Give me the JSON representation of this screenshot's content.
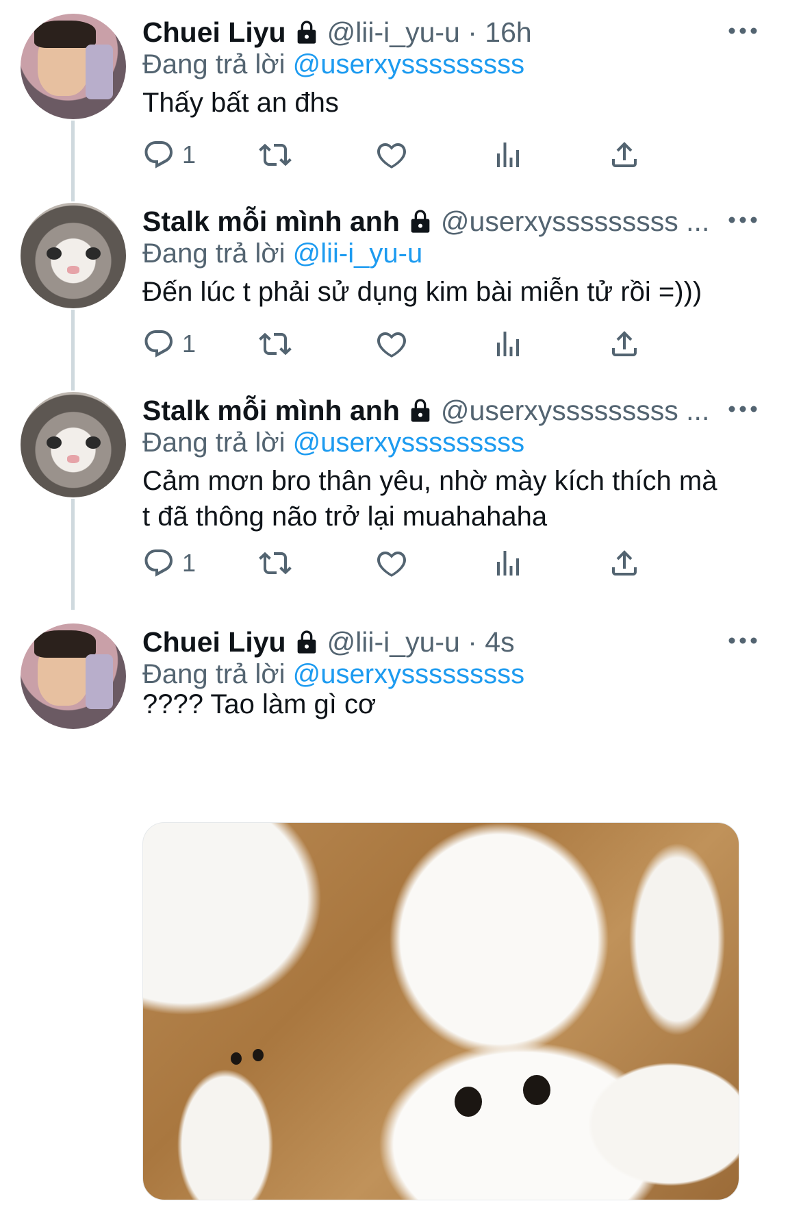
{
  "tweets": [
    {
      "name": "Chuei Liyu",
      "handle": "@lii-i_yu-u · 16h",
      "reply_prefix": "Đang trả lời ",
      "reply_mention": "@userxysssssssss",
      "text": "Thấy bất an đhs",
      "reply_count": "1",
      "avatar": "person-avatar"
    },
    {
      "name": "Stalk mỗi mình anh",
      "handle": "@userxysssssssss ...",
      "reply_prefix": "Đang trả lời ",
      "reply_mention": "@lii-i_yu-u",
      "text": "Đến lúc t phải sử dụng kim bài miễn tử rồi =)))",
      "reply_count": "1",
      "avatar": "cat-avatar"
    },
    {
      "name": "Stalk mỗi mình anh",
      "handle": "@userxysssssssss ...",
      "reply_prefix": "Đang trả lời ",
      "reply_mention": "@userxysssssssss",
      "text": "Cảm mơn bro thân yêu, nhờ mày kích thích mà\nt đã thông não trở lại muahahaha",
      "reply_count": "1",
      "avatar": "cat-avatar"
    },
    {
      "name": "Chuei Liyu",
      "handle": "@lii-i_yu-u · 4s",
      "reply_prefix": "Đang trả lời ",
      "reply_mention": "@userxysssssssss",
      "text": "???? Tao làm gì cơ",
      "avatar": "person-avatar",
      "media": "white-persian-cats-meme-image"
    }
  ],
  "icons": {
    "reply": "reply-icon",
    "retweet": "retweet-icon",
    "like": "heart-icon",
    "views": "analytics-icon",
    "share": "share-icon",
    "lock": "lock-icon",
    "more": "more-dots-icon"
  },
  "colors": {
    "link": "#1d9bf0",
    "secondary": "#536471",
    "text": "#0f1419",
    "thread_line": "#cfd9de"
  }
}
